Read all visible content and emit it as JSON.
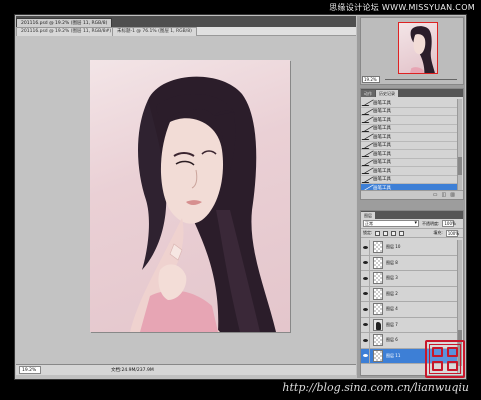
{
  "watermark_top": "思缘设计论坛 WWW.MISSYUAN.COM",
  "watermark_bottom": "http://blog.sina.com.cn/lianwuqiu",
  "document_tabs": [
    {
      "label": "201116.psd @ 19.2% (图层 11, RGB/8)"
    },
    {
      "label": "201116.psd @ 19.2% (图层 11, RGB/8#)"
    },
    {
      "label": "未标题-1 @ 76.1% (图层 1, RGB/8)"
    }
  ],
  "status_bar": {
    "zoom": "19.2%",
    "doc_info": "文档:24.9M/237.9M"
  },
  "navigator": {
    "zoom": "19.2%"
  },
  "history_panel": {
    "tabs": [
      "动作",
      "历史记录"
    ],
    "active_tab": "历史记录",
    "items": [
      "画笔工具",
      "画笔工具",
      "画笔工具",
      "画笔工具",
      "画笔工具",
      "画笔工具",
      "画笔工具",
      "画笔工具",
      "画笔工具",
      "画笔工具",
      "画笔工具"
    ],
    "selected_index": 10
  },
  "layers_panel": {
    "tab": "图层",
    "blend_mode": "正常",
    "opacity_label": "不透明度:",
    "opacity_value": "100%",
    "lock_label": "锁定:",
    "fill_label": "填充:",
    "fill_value": "100%",
    "layers": [
      {
        "name": "图层 10",
        "thumb": "transparent"
      },
      {
        "name": "图层 8",
        "thumb": "transparent"
      },
      {
        "name": "图层 3",
        "thumb": "transparent"
      },
      {
        "name": "图层 2",
        "thumb": "transparent"
      },
      {
        "name": "图层 4",
        "thumb": "transparent"
      },
      {
        "name": "图层 7",
        "thumb": "dark"
      },
      {
        "name": "图层 6",
        "thumb": "transparent"
      },
      {
        "name": "图层 11",
        "thumb": "transparent"
      }
    ],
    "selected_index": 7
  },
  "colors": {
    "selection": "#3d7fd6",
    "seal_red": "#c8172b"
  }
}
